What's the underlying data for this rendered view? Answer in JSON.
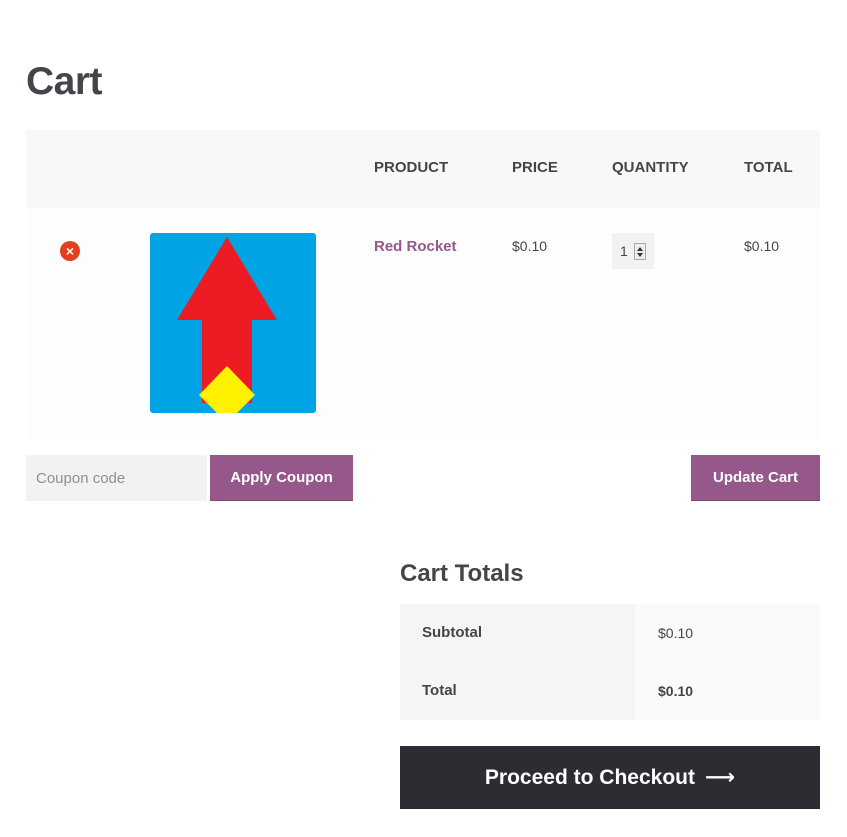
{
  "page": {
    "title": "Cart"
  },
  "cart_table": {
    "headers": {
      "product": "Product",
      "price": "Price",
      "quantity": "Quantity",
      "total": "Total"
    },
    "items": [
      {
        "name": "Red Rocket",
        "price": "$0.10",
        "quantity": "1",
        "total": "$0.10",
        "thumbnail": "red-rocket-thumbnail"
      }
    ]
  },
  "actions": {
    "coupon_placeholder": "Coupon code",
    "apply_coupon_label": "Apply Coupon",
    "update_cart_label": "Update Cart"
  },
  "cart_totals": {
    "title": "Cart Totals",
    "subtotal_label": "Subtotal",
    "subtotal_value": "$0.10",
    "total_label": "Total",
    "total_value": "$0.10"
  },
  "checkout": {
    "label": "Proceed to Checkout",
    "icon": "arrow-right-icon"
  },
  "colors": {
    "accent": "#96588a",
    "remove": "#e2401c",
    "checkout_bg": "#2c2d33",
    "thumb_bg": "#00a4e4",
    "rocket_red": "#ed1c24",
    "rocket_flame": "#fff200"
  }
}
